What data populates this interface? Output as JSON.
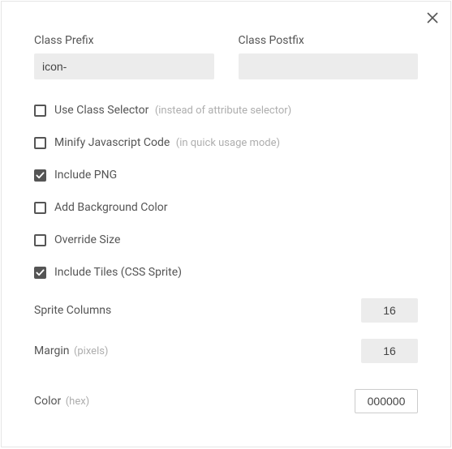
{
  "classPrefix": {
    "label": "Class Prefix",
    "value": "icon-"
  },
  "classPostfix": {
    "label": "Class Postfix",
    "value": ""
  },
  "checkboxes": {
    "useClassSelector": {
      "label": "Use Class Selector",
      "hint": "(instead of attribute selector)",
      "checked": false
    },
    "minifyJs": {
      "label": "Minify Javascript Code",
      "hint": "(in quick usage mode)",
      "checked": false
    },
    "includePng": {
      "label": "Include PNG",
      "checked": true
    },
    "addBgColor": {
      "label": "Add Background Color",
      "checked": false
    },
    "overrideSize": {
      "label": "Override Size",
      "checked": false
    },
    "includeTiles": {
      "label": "Include Tiles (CSS Sprite)",
      "checked": true
    }
  },
  "spriteColumns": {
    "label": "Sprite Columns",
    "value": "16"
  },
  "margin": {
    "label": "Margin",
    "hint": "(pixels)",
    "value": "16"
  },
  "color": {
    "label": "Color",
    "hint": "(hex)",
    "value": "000000"
  }
}
